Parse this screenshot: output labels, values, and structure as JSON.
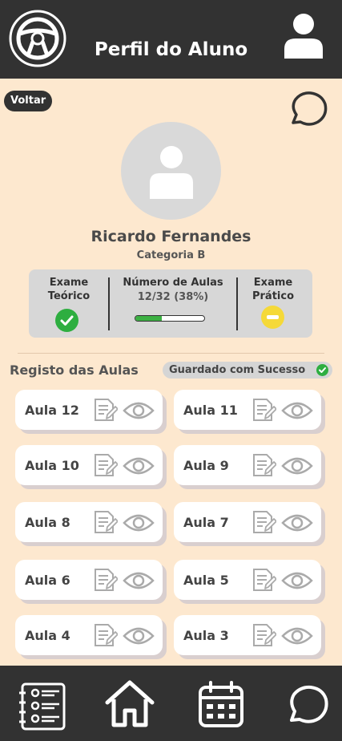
{
  "header": {
    "title": "Perfil do Aluno",
    "logo_icon": "steering-wheel-icon",
    "profile_icon": "user-icon"
  },
  "back_label": "Voltar",
  "chat_icon": "chat-bubble-icon",
  "student": {
    "name": "Ricardo Fernandes",
    "category": "Categoria B"
  },
  "status": {
    "theory_label": "Exame Teórico",
    "theory_state": "approved",
    "lessons_label": "Número de Aulas",
    "lessons_count": "12/32 (38%)",
    "lessons_progress_fraction": 0.38,
    "practical_label": "Exame Prático",
    "practical_state": "pending"
  },
  "section_title": "Registo das Aulas",
  "saved_label": "Guardado com Sucesso",
  "lessons": [
    "Aula 12",
    "Aula 11",
    "Aula 10",
    "Aula 9",
    "Aula 8",
    "Aula 7",
    "Aula 6",
    "Aula 5",
    "Aula 4",
    "Aula 3"
  ],
  "nav": [
    "student-list-icon",
    "home-icon",
    "calendar-icon",
    "chat-bubble-icon"
  ],
  "colors": {
    "dark": "#323232",
    "background": "#fde8cf",
    "success": "#2eae40",
    "pending": "#f5d938"
  }
}
